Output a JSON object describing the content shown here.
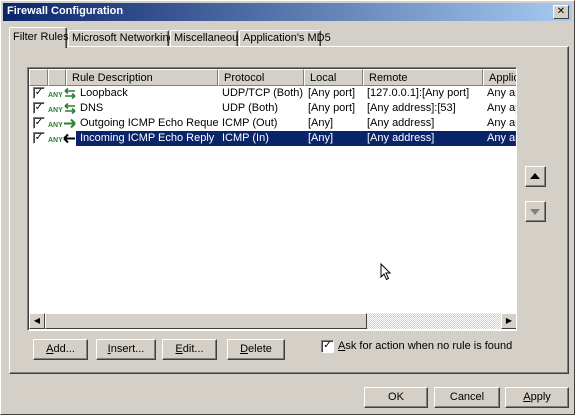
{
  "window": {
    "title": "Firewall Configuration",
    "close_glyph": "✕"
  },
  "tabs": [
    {
      "label": "Filter Rules",
      "active": true
    },
    {
      "label": "Microsoft Networking",
      "active": false
    },
    {
      "label": "Miscellaneous",
      "active": false
    },
    {
      "label": "Application's MD5",
      "active": false
    }
  ],
  "table": {
    "columns": [
      "Rule Description",
      "Protocol",
      "Local",
      "Remote",
      "Applica"
    ],
    "rows": [
      {
        "checked": true,
        "icon": "bidirectional-arrows-icon",
        "description": "Loopback",
        "protocol": "UDP/TCP (Both)",
        "local": "[Any port]",
        "remote": "[127.0.0.1]:[Any port]",
        "app": "Any ap"
      },
      {
        "checked": true,
        "icon": "bidirectional-arrows-icon",
        "description": "DNS",
        "protocol": "UDP (Both)",
        "local": "[Any port]",
        "remote": "[Any address]:[53]",
        "app": "Any ap"
      },
      {
        "checked": true,
        "icon": "outgoing-arrow-icon",
        "description": "Outgoing ICMP Echo Request",
        "protocol": "ICMP (Out)",
        "local": "[Any]",
        "remote": "[Any address]",
        "app": "Any ap"
      },
      {
        "checked": true,
        "icon": "incoming-arrow-icon",
        "description": "Incoming ICMP Echo Reply",
        "protocol": "ICMP (In)",
        "local": "[Any]",
        "remote": "[Any address]",
        "app": "Any ap",
        "selected": true
      }
    ],
    "any_label": "ANY",
    "check_glyph": "✓"
  },
  "buttons": {
    "add": {
      "pre": "",
      "mnemonic": "A",
      "post": "dd..."
    },
    "insert": {
      "pre": "",
      "mnemonic": "I",
      "post": "nsert..."
    },
    "edit": {
      "pre": "",
      "mnemonic": "E",
      "post": "dit..."
    },
    "delete": {
      "pre": "",
      "mnemonic": "D",
      "post": "elete"
    },
    "ok": "OK",
    "cancel": "Cancel",
    "apply": {
      "pre": "",
      "mnemonic": "A",
      "post": "pply"
    }
  },
  "ask_option": {
    "checked": true,
    "pre": "",
    "mnemonic": "A",
    "post": "sk for action when no rule is found"
  },
  "colors": {
    "accent": "#0a246a",
    "arrow_green": "#2e7d32",
    "face": "#d4d0c8"
  }
}
